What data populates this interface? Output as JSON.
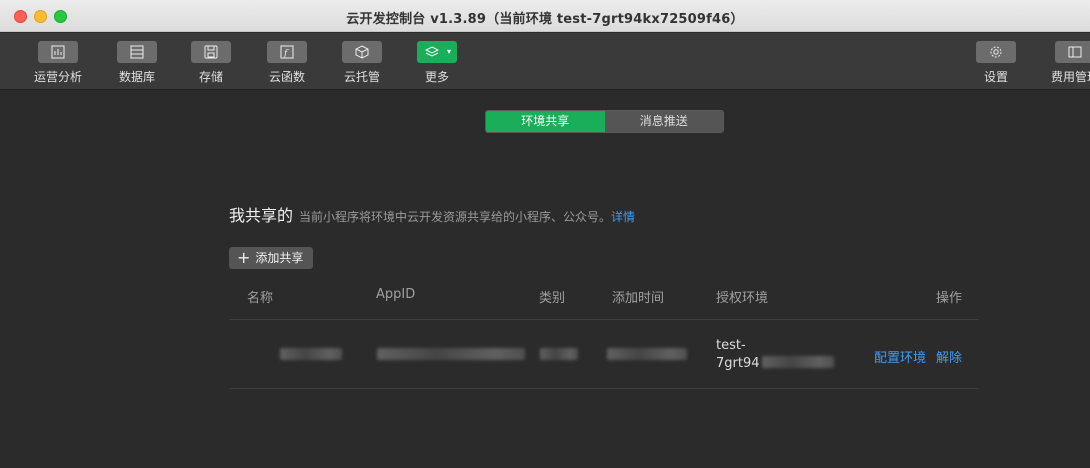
{
  "window": {
    "title": "云开发控制台 v1.3.89（当前环境 test-7grt94kx72509f46）"
  },
  "toolbar": {
    "items": [
      {
        "label": "运营分析",
        "icon": "bar-chart-icon"
      },
      {
        "label": "数据库",
        "icon": "database-icon"
      },
      {
        "label": "存储",
        "icon": "storage-icon"
      },
      {
        "label": "云函数",
        "icon": "function-icon"
      },
      {
        "label": "云托管",
        "icon": "cube-icon"
      },
      {
        "label": "更多",
        "icon": "layers-icon"
      },
      {
        "label": "设置",
        "icon": "gear-icon"
      },
      {
        "label": "费用管理",
        "icon": "billing-icon"
      }
    ],
    "active_color": "#1aad5a"
  },
  "tabs": [
    {
      "label": "环境共享",
      "active": true
    },
    {
      "label": "消息推送",
      "active": false
    }
  ],
  "section": {
    "title": "我共享的",
    "description": "当前小程序将环境中云开发资源共享给的小程序、公众号。",
    "link": "详情"
  },
  "add_button": {
    "label": "添加共享"
  },
  "table": {
    "columns": [
      "名称",
      "AppID",
      "类别",
      "添加时间",
      "授权环境",
      "操作"
    ],
    "rows": [
      {
        "name": "",
        "appid": "",
        "type": "",
        "time": "",
        "env_line1": "test-",
        "env_line2": "7grt94",
        "actions": [
          "配置环境",
          "解除"
        ]
      }
    ]
  },
  "colors": {
    "accent": "#1aad5a",
    "link": "#3f9cf1",
    "background": "#2b2b2b"
  }
}
